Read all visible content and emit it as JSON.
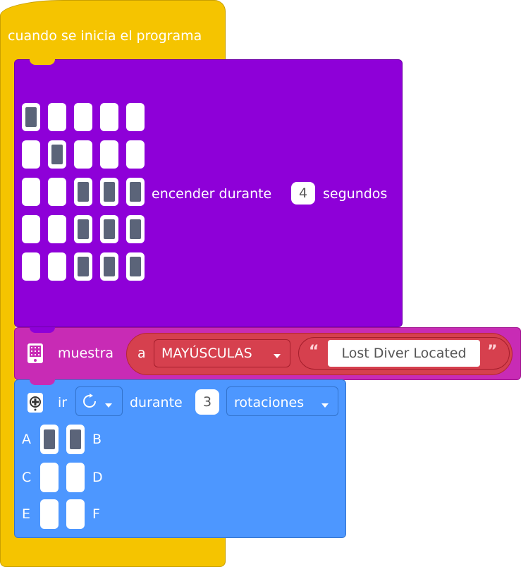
{
  "hat": {
    "label": "cuando se inicia el programa",
    "color": "#f5c400"
  },
  "light_matrix": {
    "grid": [
      [
        1,
        0,
        0,
        0,
        0
      ],
      [
        0,
        1,
        0,
        0,
        0
      ],
      [
        0,
        0,
        1,
        1,
        1
      ],
      [
        0,
        0,
        1,
        1,
        1
      ],
      [
        0,
        0,
        1,
        1,
        1
      ]
    ],
    "action_label": "encender durante",
    "duration": "4",
    "unit_label": "segundos",
    "color": "#8e00d8"
  },
  "display": {
    "label": "muestra",
    "icon": "light-matrix-icon",
    "case_prefix": "a",
    "case_option": "MAYÚSCULAS",
    "text": "Lost Diver Located",
    "open_quote": "“",
    "close_quote": "”",
    "color": "#c82bb5",
    "reporter_color": "#d6404e"
  },
  "motor": {
    "icon": "motor-icon",
    "label": "ir",
    "direction_icon": "clockwise-icon",
    "during_label": "durante",
    "amount": "3",
    "unit_option": "rotaciones",
    "ports": [
      {
        "left": "A",
        "right": "B",
        "left_on": true,
        "right_on": true
      },
      {
        "left": "C",
        "right": "D",
        "left_on": false,
        "right_on": false
      },
      {
        "left": "E",
        "right": "F",
        "left_on": false,
        "right_on": false
      }
    ],
    "color": "#4d97ff"
  }
}
